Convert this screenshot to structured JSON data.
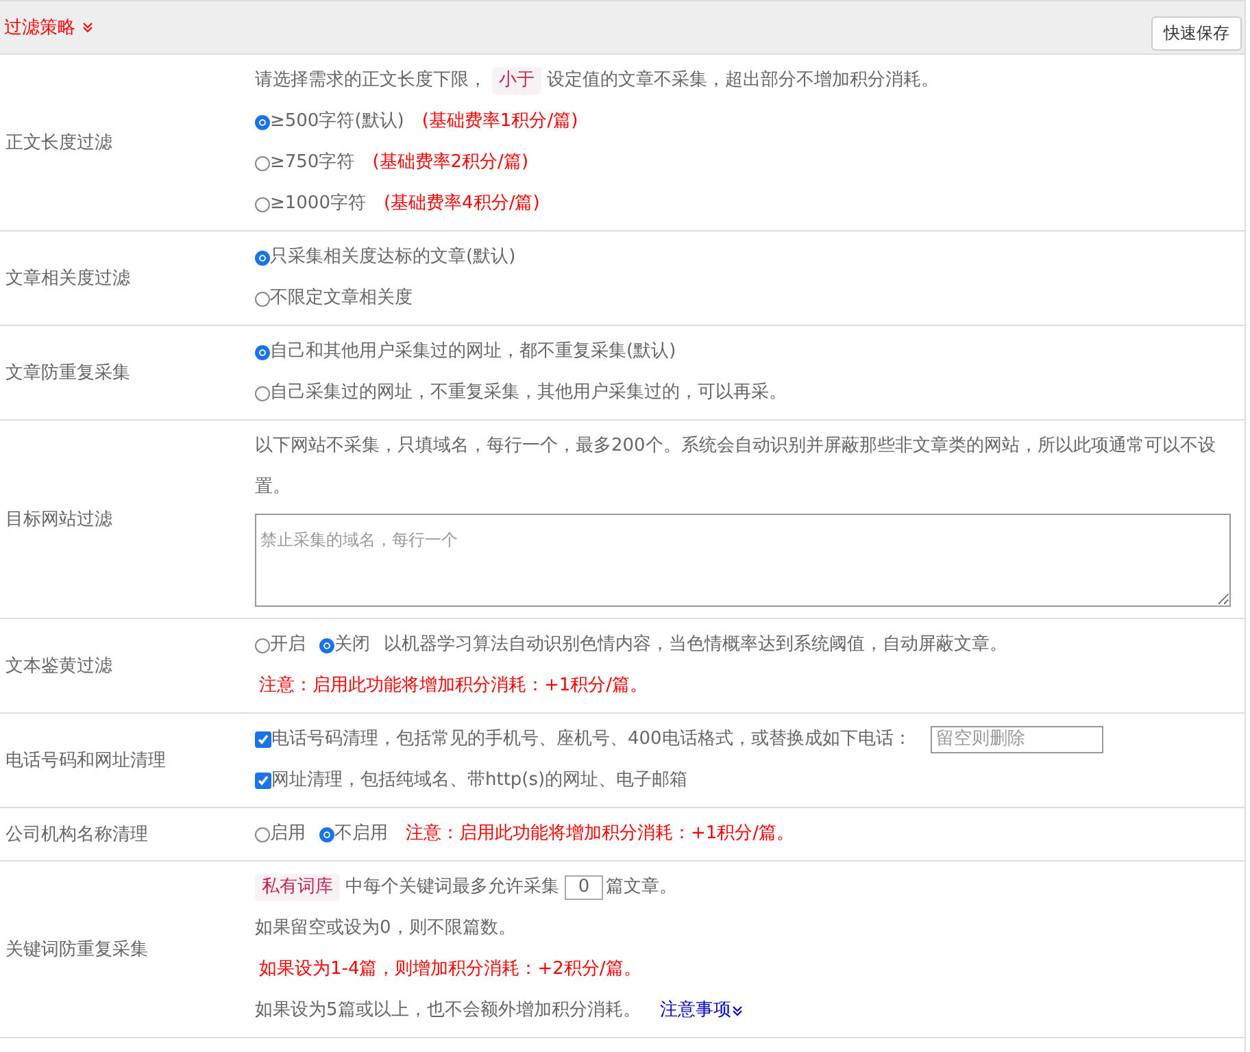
{
  "header": {
    "title": "过滤策略",
    "save_button": "快速保存"
  },
  "sections": [
    {
      "label": "正文长度过滤",
      "lines": [
        [
          {
            "kind": "text",
            "text": "请选择需求的正文长度下限，"
          },
          {
            "kind": "tag",
            "text": "小于"
          },
          {
            "kind": "text",
            "text": "设定值的文章不采集，超出部分不增加积分消耗。"
          }
        ],
        [
          {
            "kind": "radio",
            "text": "≥500字符(默认)",
            "selected": true
          },
          {
            "kind": "note",
            "text": "(基础费率1积分/篇)"
          }
        ],
        [
          {
            "kind": "radio",
            "text": "≥750字符",
            "selected": false
          },
          {
            "kind": "note",
            "text": "(基础费率2积分/篇)"
          }
        ],
        [
          {
            "kind": "radio",
            "text": "≥1000字符",
            "selected": false
          },
          {
            "kind": "note",
            "text": "(基础费率4积分/篇)"
          }
        ]
      ]
    },
    {
      "label": "文章相关度过滤",
      "lines": [
        [
          {
            "kind": "radio",
            "text": "只采集相关度达标的文章(默认)",
            "selected": true
          }
        ],
        [
          {
            "kind": "radio",
            "text": "不限定文章相关度",
            "selected": false
          }
        ]
      ]
    },
    {
      "label": "文章防重复采集",
      "lines": [
        [
          {
            "kind": "radio",
            "text": "自己和其他用户采集过的网址，都不重复采集(默认)",
            "selected": true
          }
        ],
        [
          {
            "kind": "radio",
            "text": "自己采集过的网址，不重复采集，其他用户采集过的，可以再采。",
            "selected": false
          }
        ]
      ]
    },
    {
      "label": "目标网站过滤",
      "lines": [
        [
          {
            "kind": "text",
            "text": "以下网站不采集，只填域名，每行一个，最多200个。系统会自动识别并屏蔽那些非文章类的网站，所以此项通常可以不设置。"
          }
        ],
        [
          {
            "kind": "textarea",
            "placeholder": "禁止采集的域名，每行一个"
          }
        ]
      ]
    },
    {
      "label": "文本鉴黄过滤",
      "lines": [
        [
          {
            "kind": "radio",
            "text": "开启",
            "selected": false
          },
          {
            "kind": "radio",
            "text": "关闭",
            "selected": true
          },
          {
            "kind": "text",
            "text": "以机器学习算法自动识别色情内容，当色情概率达到系统阈值，自动屏蔽文章。"
          }
        ],
        [
          {
            "kind": "note",
            "text": "注意：启用此功能将增加积分消耗：+1积分/篇。"
          }
        ]
      ]
    },
    {
      "label": "电话号码和网址清理",
      "lines": [
        [
          {
            "kind": "checkbox",
            "text": "电话号码清理，包括常见的手机号、座机号、400电话格式，或替换成如下电话：",
            "checked": true
          },
          {
            "kind": "input",
            "placeholder": "留空则删除"
          }
        ],
        [
          {
            "kind": "checkbox",
            "text": "网址清理，包括纯域名、带http(s)的网址、电子邮箱",
            "checked": true
          }
        ]
      ]
    },
    {
      "label": "公司机构名称清理",
      "lines": [
        [
          {
            "kind": "radio",
            "text": "启用",
            "selected": false
          },
          {
            "kind": "radio",
            "text": "不启用",
            "selected": true
          },
          {
            "kind": "note",
            "text": "注意：启用此功能将增加积分消耗：+1积分/篇。"
          }
        ]
      ]
    },
    {
      "label": "关键词防重复采集",
      "lines": [
        [
          {
            "kind": "tag",
            "text": "私有词库"
          },
          {
            "kind": "text",
            "text": "中每个关键词最多允许采集"
          },
          {
            "kind": "number",
            "value": "0"
          },
          {
            "kind": "text",
            "text": "篇文章。"
          }
        ],
        [
          {
            "kind": "text",
            "text": "如果留空或设为0，则不限篇数。"
          }
        ],
        [
          {
            "kind": "note",
            "text": "如果设为1-4篇，则增加积分消耗：+2积分/篇。"
          }
        ],
        [
          {
            "kind": "text",
            "text": "如果设为5篇或以上，也不会额外增加积分消耗。"
          },
          {
            "kind": "link",
            "text": "注意事项"
          }
        ]
      ]
    }
  ]
}
